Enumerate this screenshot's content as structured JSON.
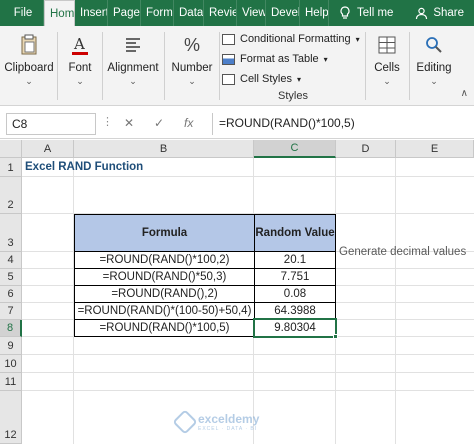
{
  "tabs": [
    "File",
    "Home",
    "Insert",
    "Page L",
    "Formu",
    "Data",
    "Revie",
    "View",
    "Devel",
    "Help"
  ],
  "active_tab_index": 1,
  "tell_me": "Tell me",
  "share": "Share",
  "ribbon": {
    "clipboard": "Clipboard",
    "font": "Font",
    "alignment": "Alignment",
    "number": "Number",
    "styles": {
      "conditional": "Conditional Formatting",
      "format_table": "Format as Table",
      "cell_styles": "Cell Styles",
      "group_label": "Styles"
    },
    "cells": "Cells",
    "editing": "Editing"
  },
  "formula_bar": {
    "name_box": "C8",
    "formula": "=ROUND(RAND()*100,5)"
  },
  "columns": [
    "A",
    "B",
    "C",
    "D",
    "E"
  ],
  "selected_column": "C",
  "rows": [
    "1",
    "2",
    "3",
    "4",
    "5",
    "6",
    "7",
    "8",
    "9",
    "10",
    "11",
    "12"
  ],
  "selected_row": "8",
  "sheet": {
    "title": "Excel RAND Function",
    "table_headers": [
      "Formula",
      "Random Value"
    ],
    "table_rows": [
      [
        "=ROUND(RAND()*100,2)",
        "20.1"
      ],
      [
        "=ROUND(RAND()*50,3)",
        "7.751"
      ],
      [
        "=ROUND(RAND(),2)",
        "0.08"
      ],
      [
        "=ROUND(RAND()*(100-50)+50,4)",
        "64.3988"
      ],
      [
        "=ROUND(RAND()*100,5)",
        "9.80304"
      ]
    ],
    "note": "Generate decimal values"
  },
  "watermark": {
    "name": "exceldemy",
    "tagline": "EXCEL · DATA · BI"
  },
  "colors": {
    "excel_green": "#217346",
    "table_header": "#b4c7e7",
    "title_blue": "#1f4e79"
  }
}
